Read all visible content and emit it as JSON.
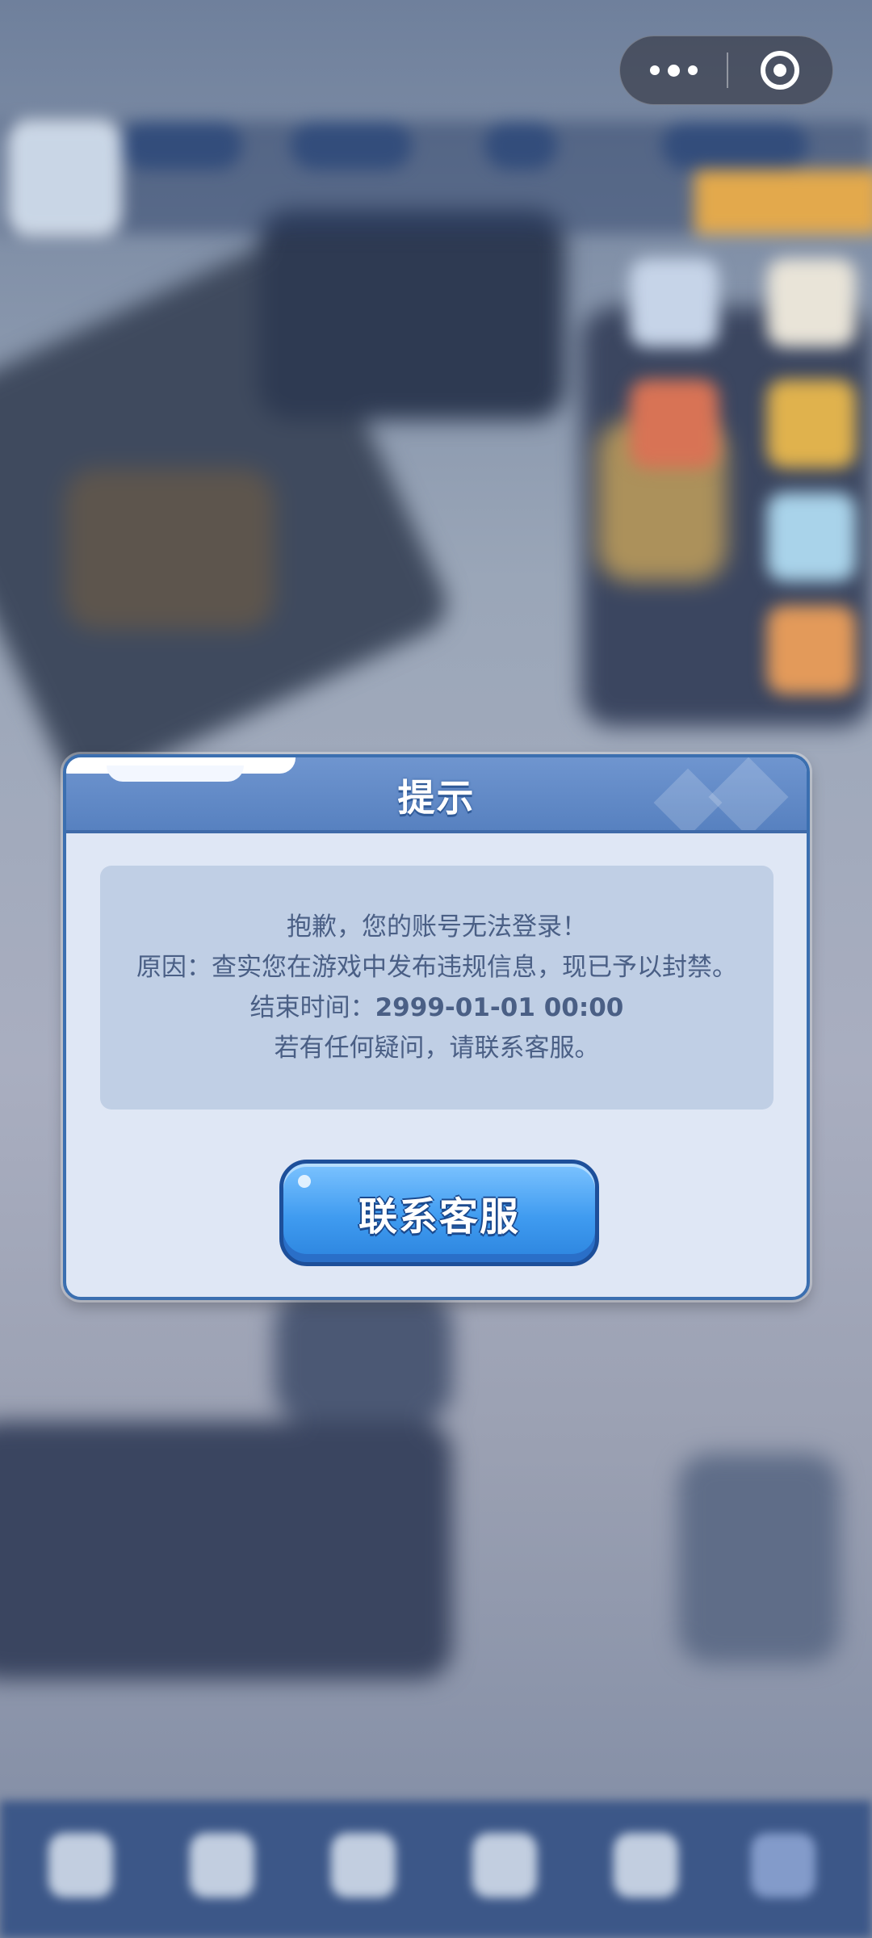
{
  "dialog": {
    "title": "提示",
    "message_line1": "抱歉，您的账号无法登录！",
    "message_line2": "原因：查实您在游戏中发布违规信息，现已予以封禁。",
    "end_time_label": "结束时间：",
    "end_time_value": "2999-01-01 00:00",
    "message_line4": "若有任何疑问，请联系客服。",
    "button_label": "联系客服"
  },
  "capsule": {
    "more_icon": "more-dots-icon",
    "close_icon": "miniprogram-close-icon"
  },
  "colors": {
    "header": "#5781c0",
    "dialog_bg": "#dfe7f5",
    "message_bg": "#c0cfe5",
    "message_text": "#4a5f85",
    "button": "#3f9bf0"
  }
}
